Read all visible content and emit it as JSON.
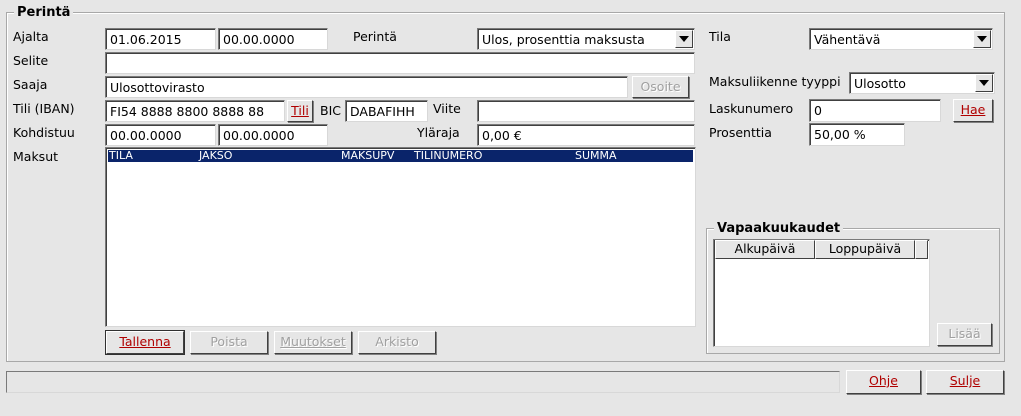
{
  "group_title": "Perintä",
  "labels": {
    "ajalta": "Ajalta",
    "selite": "Selite",
    "saaja": "Saaja",
    "tili_iban": "Tili (IBAN)",
    "kohdistuu": "Kohdistuu",
    "maksut": "Maksut",
    "perinta": "Perintä",
    "bic": "BIC",
    "viite": "Viite",
    "ylaraja": "Yläraja",
    "tila": "Tila",
    "maksuliikenne_tyyppi": "Maksuliikenne tyyppi",
    "laskunumero": "Laskunumero",
    "prosenttia": "Prosenttia"
  },
  "fields": {
    "ajalta_from": "01.06.2015",
    "ajalta_to": "00.00.0000",
    "selite": "",
    "saaja": "Ulosottovirasto",
    "tili_iban": "FI54 8888 8800 8888 88",
    "bic": "DABAFIHH",
    "viite": "",
    "kohdistuu_from": "00.00.0000",
    "kohdistuu_to": "00.00.0000",
    "ylaraja": "0,00 €",
    "perinta_select": "Ulos, prosenttia maksusta",
    "tila_select": "Vähentävä",
    "maksuliikenne_select": "Ulosotto",
    "laskunumero": "0",
    "prosenttia": "50,00 %"
  },
  "buttons": {
    "osoite": "Osoite",
    "tili": "Tili",
    "hae": "Hae",
    "tallenna": "Tallenna",
    "poista": "Poista",
    "muutokset": "Muutokset",
    "arkisto": "Arkisto",
    "lisaa": "Lisää",
    "ohje": "Ohje",
    "sulje": "Sulje"
  },
  "maksut_columns": [
    "TILA",
    "JAKSO",
    "MAKSUPV",
    "TILINUMERO",
    "SUMMA"
  ],
  "vapaakuukaudet": {
    "title": "Vapaakuukaudet",
    "columns": [
      "Alkupäivä",
      "Loppupäivä"
    ]
  },
  "status_text": "",
  "colors": {
    "background": "#e6e6e6",
    "header_selection": "#0a246a",
    "accent_text": "#b00000"
  }
}
